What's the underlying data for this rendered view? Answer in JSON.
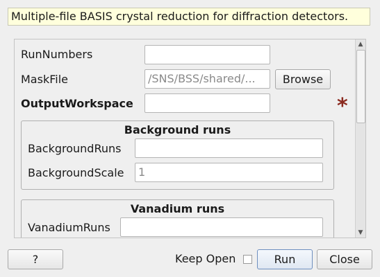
{
  "description": "Multiple-file BASIS crystal reduction for diffraction detectors.",
  "form": {
    "run_numbers": {
      "label": "RunNumbers",
      "value": ""
    },
    "mask_file": {
      "label": "MaskFile",
      "value": "/SNS/BSS/shared/...",
      "browse_label": "Browse"
    },
    "output_workspace": {
      "label": "OutputWorkspace",
      "value": "",
      "required_marker": "*"
    },
    "background_group": {
      "title": "Background runs",
      "background_runs": {
        "label": "BackgroundRuns",
        "value": ""
      },
      "background_scale": {
        "label": "BackgroundScale",
        "placeholder": "1"
      }
    },
    "vanadium_group": {
      "title": "Vanadium runs",
      "vanadium_runs": {
        "label": "VanadiumRuns",
        "value": ""
      }
    }
  },
  "scrollbar": {
    "up_arrow": "▲",
    "down_arrow": "▼"
  },
  "footer": {
    "help_label": "?",
    "keep_open_label": "Keep Open",
    "keep_open_checked": false,
    "run_label": "Run",
    "close_label": "Close"
  },
  "colors": {
    "description_bg": "#ffffdc",
    "required_star": "#8b2a1f",
    "window_bg": "#efefef"
  }
}
